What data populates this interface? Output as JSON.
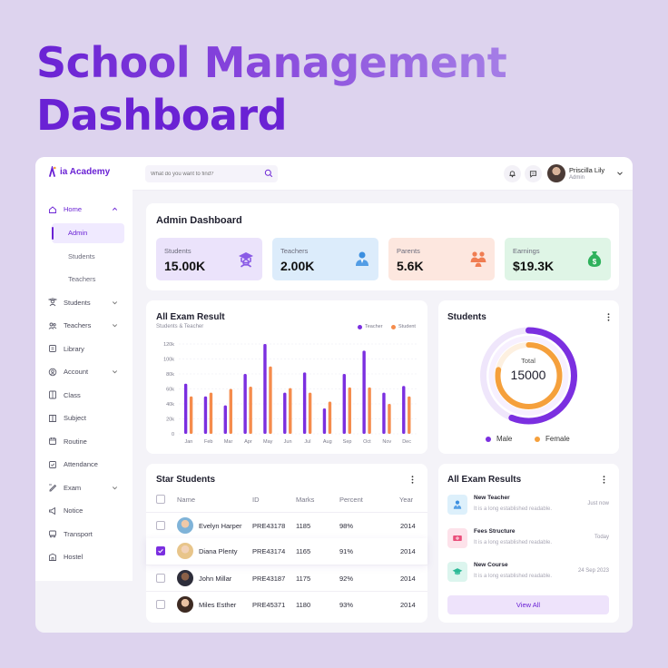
{
  "hero": {
    "line1": "School Management",
    "line2": "Dashboard"
  },
  "brand": {
    "name": "ia Academy"
  },
  "sidebar": {
    "items": [
      {
        "label": "Home",
        "icon": "home-icon",
        "expand": true,
        "active": true
      },
      {
        "label": "Students",
        "icon": "students-icon",
        "expand": true
      },
      {
        "label": "Teachers",
        "icon": "teachers-icon",
        "expand": true
      },
      {
        "label": "Library",
        "icon": "library-icon"
      },
      {
        "label": "Account",
        "icon": "account-icon",
        "expand": true
      },
      {
        "label": "Class",
        "icon": "class-icon"
      },
      {
        "label": "Subject",
        "icon": "subject-icon"
      },
      {
        "label": "Routine",
        "icon": "routine-icon"
      },
      {
        "label": "Attendance",
        "icon": "attendance-icon"
      },
      {
        "label": "Exam",
        "icon": "exam-icon",
        "expand": true
      },
      {
        "label": "Notice",
        "icon": "notice-icon"
      },
      {
        "label": "Transport",
        "icon": "transport-icon"
      },
      {
        "label": "Hostel",
        "icon": "hostel-icon"
      }
    ],
    "home_sub": [
      "Admin",
      "Students",
      "Teachers"
    ]
  },
  "topbar": {
    "search_placeholder": "What do you want to find?",
    "user_name": "Priscilla Lily",
    "user_role": "Admin"
  },
  "admin": {
    "title": "Admin Dashboard",
    "stats": [
      {
        "label": "Students",
        "value": "15.00K",
        "bg": "#ebe3fb",
        "icon": "graduate-icon",
        "color": "#8a5be6"
      },
      {
        "label": "Teachers",
        "value": "2.00K",
        "bg": "#dcecfb",
        "icon": "teacher-icon",
        "color": "#3b8fe0"
      },
      {
        "label": "Parents",
        "value": "5.6K",
        "bg": "#fde7df",
        "icon": "parents-icon",
        "color": "#f07d52"
      },
      {
        "label": "Earnings",
        "value": "$19.3K",
        "bg": "#dff5e6",
        "icon": "money-bag-icon",
        "color": "#2fb15c"
      }
    ]
  },
  "exam_chart": {
    "title": "All Exam Result",
    "subtitle": "Students & Teacher",
    "legend": {
      "teacher": "Teacher",
      "student": "Student"
    }
  },
  "chart_data": {
    "type": "bar",
    "categories": [
      "Jan",
      "Feb",
      "Mar",
      "Apr",
      "May",
      "Jun",
      "Jul",
      "Aug",
      "Sep",
      "Oct",
      "Nov",
      "Dec"
    ],
    "series": [
      {
        "name": "Teacher",
        "color": "#7b2fe0",
        "values": [
          67,
          50,
          38,
          80,
          120,
          55,
          82,
          34,
          80,
          111,
          55,
          64
        ]
      },
      {
        "name": "Student",
        "color": "#f58c4c",
        "values": [
          50,
          55,
          60,
          63,
          90,
          61,
          55,
          43,
          62,
          62,
          40,
          50
        ]
      }
    ],
    "yticks": [
      "0",
      "20k",
      "40k",
      "60k",
      "80k",
      "100k",
      "120k"
    ],
    "ylim": [
      0,
      120
    ],
    "legend_position": "top-right",
    "grid": true
  },
  "students_panel": {
    "title": "Students",
    "total_label": "Total",
    "total_value": "15000",
    "legend": {
      "male": "Male",
      "female": "Female"
    },
    "male_fraction": 0.56,
    "female_fraction": 0.44,
    "male_color": "#7b2fe0",
    "female_color": "#f5a03c"
  },
  "star_students": {
    "title": "Star Students",
    "headers": [
      "Name",
      "ID",
      "Marks",
      "Percent",
      "Year"
    ],
    "rows": [
      {
        "name": "Evelyn Harper",
        "id": "PRE43178",
        "marks": "1185",
        "percent": "98%",
        "year": "2014",
        "checked": false
      },
      {
        "name": "Diana Plenty",
        "id": "PRE43174",
        "marks": "1165",
        "percent": "91%",
        "year": "2014",
        "checked": true
      },
      {
        "name": "John Millar",
        "id": "PRE43187",
        "marks": "1175",
        "percent": "92%",
        "year": "2014",
        "checked": false
      },
      {
        "name": "Miles Esther",
        "id": "PRE45371",
        "marks": "1180",
        "percent": "93%",
        "year": "2014",
        "checked": false
      }
    ]
  },
  "exam_results": {
    "title": "All Exam Results",
    "items": [
      {
        "title": "New Teacher",
        "desc": "It is a long established readable.",
        "time": "Just now",
        "bg": "#ddf0fb",
        "color": "#3b8fe0",
        "icon": "teacher-icon"
      },
      {
        "title": "Fees Structure",
        "desc": "It is a long established readable.",
        "time": "Today",
        "bg": "#fde2ea",
        "color": "#ea4f7b",
        "icon": "money-icon"
      },
      {
        "title": "New Course",
        "desc": "It is a long established readable.",
        "time": "24 Sep 2023",
        "bg": "#dcf5ee",
        "color": "#2bb996",
        "icon": "graduation-cap-icon"
      }
    ],
    "view_all": "View All"
  }
}
